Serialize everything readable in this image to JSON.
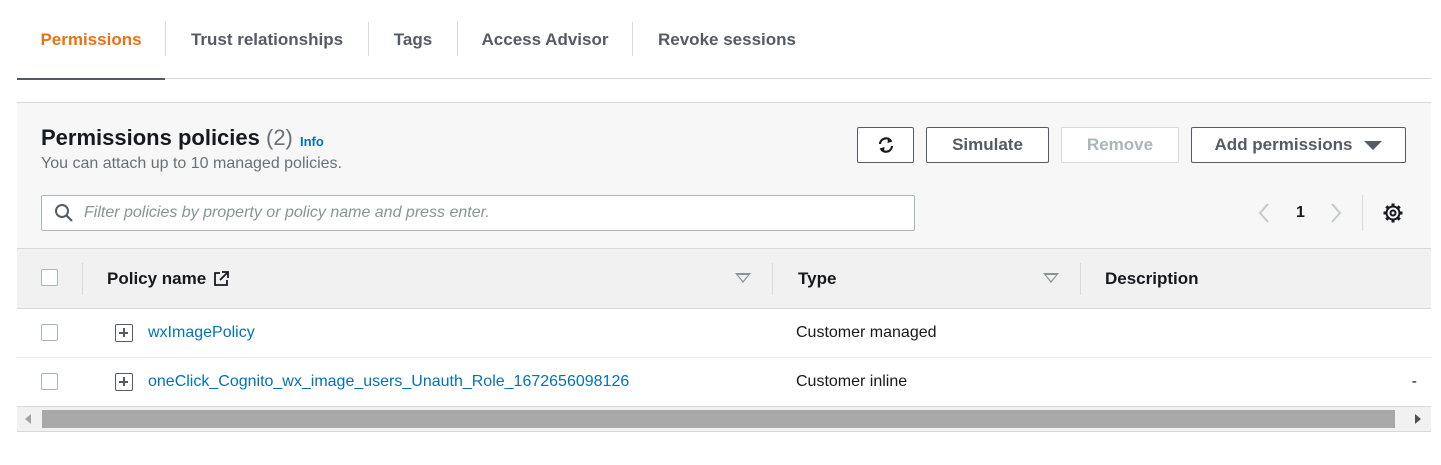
{
  "tabs": [
    {
      "label": "Permissions",
      "active": true
    },
    {
      "label": "Trust relationships",
      "active": false
    },
    {
      "label": "Tags",
      "active": false
    },
    {
      "label": "Access Advisor",
      "active": false
    },
    {
      "label": "Revoke sessions",
      "active": false
    }
  ],
  "panel": {
    "title": "Permissions policies",
    "count": "(2)",
    "info_link": "Info",
    "subtitle": "You can attach up to 10 managed policies.",
    "buttons": {
      "refresh_icon": "refresh-icon",
      "simulate": "Simulate",
      "remove": "Remove",
      "add_permissions": "Add permissions"
    },
    "search": {
      "placeholder": "Filter policies by property or policy name and press enter.",
      "value": ""
    },
    "pagination": {
      "current_page": "1"
    }
  },
  "table": {
    "columns": [
      "Policy name",
      "Type",
      "Description"
    ],
    "rows": [
      {
        "name": "wxImagePolicy",
        "type": "Customer managed",
        "description": ""
      },
      {
        "name": "oneClick_Cognito_wx_image_users_Unauth_Role_1672656098126",
        "type": "Customer inline",
        "description": "-"
      }
    ]
  },
  "colors": {
    "active_tab": "#ec7211",
    "link": "#0073bb",
    "muted_text": "#687078",
    "header_bg": "#f1f1f1"
  }
}
